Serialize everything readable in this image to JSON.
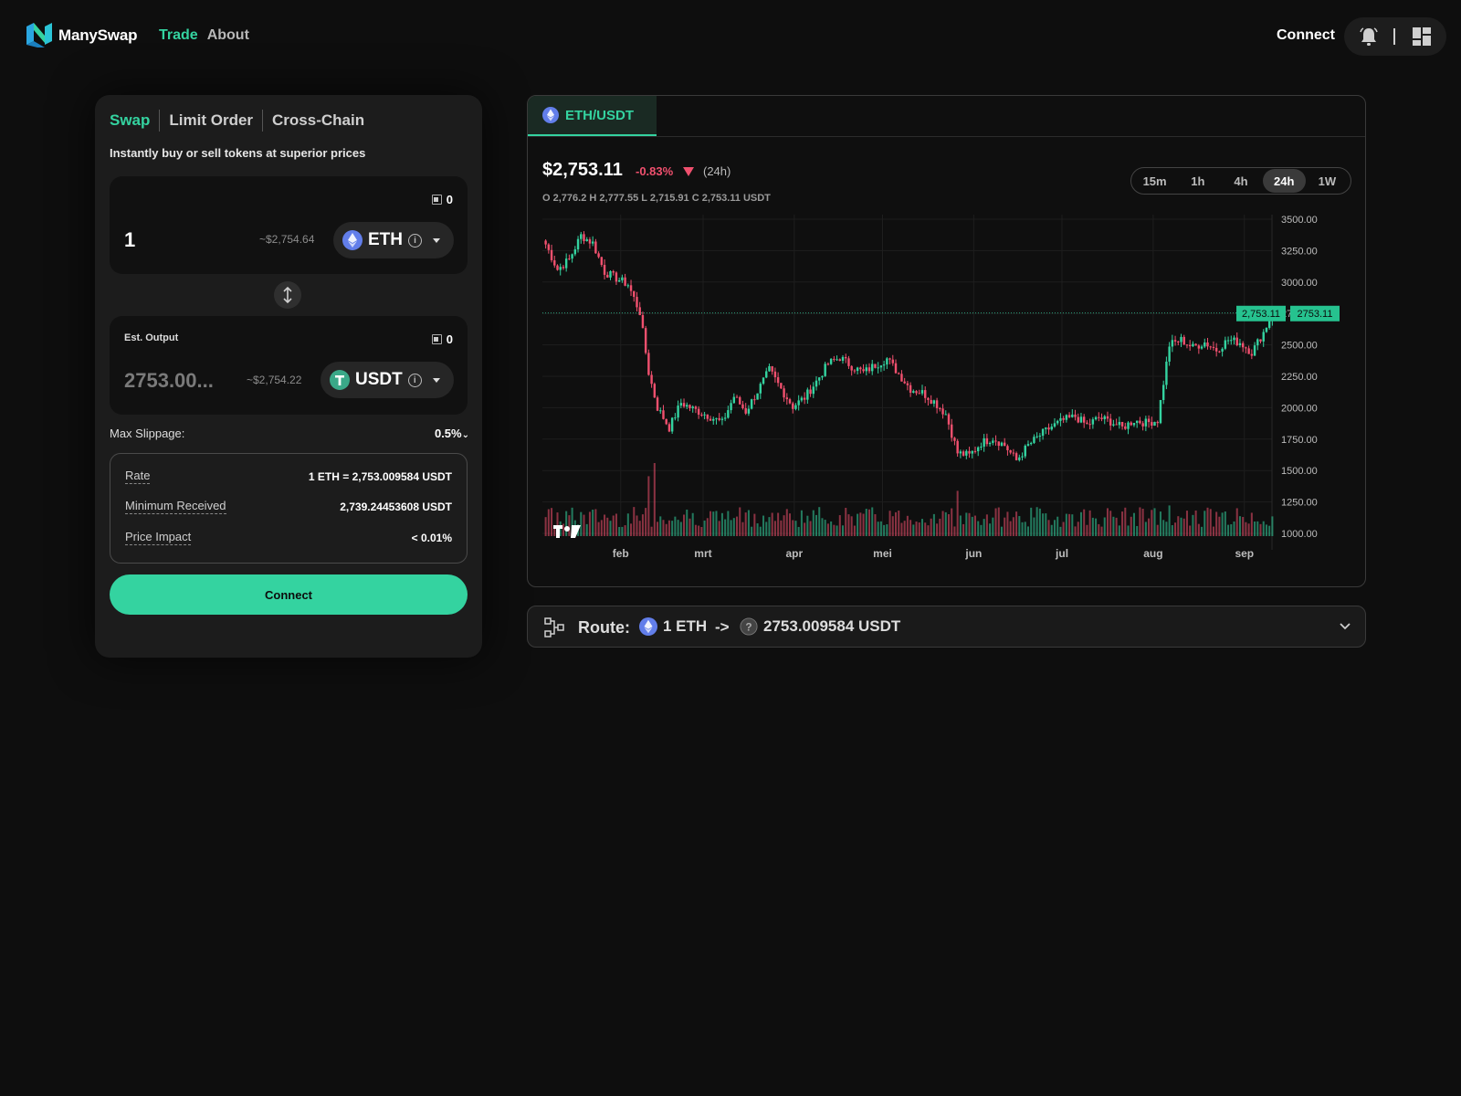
{
  "brand": {
    "name": "ManySwap",
    "accent": "#34d3a0",
    "down": "#f0506e"
  },
  "nav": {
    "trade": "Trade",
    "about": "About"
  },
  "header": {
    "connect": "Connect"
  },
  "swap": {
    "tabs": [
      "Swap",
      "Limit Order",
      "Cross-Chain"
    ],
    "subtitle": "Instantly buy or sell tokens at superior prices",
    "input": {
      "balance": "0",
      "amount": "1",
      "usd": "~$2,754.64",
      "token": "ETH"
    },
    "output": {
      "label": "Est. Output",
      "balance": "0",
      "amount": "2753.00...",
      "usd": "~$2,754.22",
      "token": "USDT"
    },
    "slippage_label": "Max Slippage:",
    "slippage_value": "0.5%",
    "details": [
      {
        "label": "Rate",
        "value": "1 ETH = 2,753.009584 USDT"
      },
      {
        "label": "Minimum Received",
        "value": "2,739.24453608 USDT"
      },
      {
        "label": "Price Impact",
        "value": "< 0.01%"
      }
    ],
    "connect": "Connect"
  },
  "chart": {
    "pair": "ETH/USDT",
    "price": "$2,753.11",
    "change": "-0.83%",
    "period": "(24h)",
    "ohlc": "O 2,776.2 H 2,777.55 L 2,715.91 C 2,753.11 USDT",
    "timeframes": [
      "15m",
      "1h",
      "4h",
      "24h",
      "1W"
    ],
    "active_timeframe": "24h",
    "last_label": "2,753.11",
    "last_axis_label": "2753.11"
  },
  "chart_data": {
    "type": "candlestick",
    "yticks": [
      "3500.00",
      "3250.00",
      "3000.00",
      "2750.00",
      "2500.00",
      "2250.00",
      "2000.00",
      "1750.00",
      "1500.00",
      "1250.00",
      "1000.00"
    ],
    "ylim": [
      1000,
      3500
    ],
    "xticks": [
      "feb",
      "mrt",
      "apr",
      "mei",
      "jun",
      "jul",
      "aug",
      "sep"
    ],
    "last_price": 2753.11,
    "close_anchors": [
      [
        0,
        3300
      ],
      [
        4,
        3100
      ],
      [
        8,
        3180
      ],
      [
        12,
        3370
      ],
      [
        16,
        3310
      ],
      [
        20,
        3080
      ],
      [
        24,
        3030
      ],
      [
        28,
        2980
      ],
      [
        32,
        2760
      ],
      [
        35,
        2280
      ],
      [
        38,
        2000
      ],
      [
        42,
        1840
      ],
      [
        46,
        2040
      ],
      [
        50,
        1990
      ],
      [
        55,
        1940
      ],
      [
        60,
        1880
      ],
      [
        64,
        2090
      ],
      [
        68,
        1970
      ],
      [
        72,
        2130
      ],
      [
        76,
        2300
      ],
      [
        80,
        2150
      ],
      [
        84,
        2010
      ],
      [
        88,
        2080
      ],
      [
        92,
        2210
      ],
      [
        96,
        2350
      ],
      [
        100,
        2400
      ],
      [
        104,
        2330
      ],
      [
        108,
        2280
      ],
      [
        112,
        2340
      ],
      [
        116,
        2390
      ],
      [
        120,
        2270
      ],
      [
        124,
        2150
      ],
      [
        128,
        2120
      ],
      [
        132,
        2050
      ],
      [
        136,
        1950
      ],
      [
        140,
        1640
      ],
      [
        144,
        1620
      ],
      [
        148,
        1720
      ],
      [
        152,
        1760
      ],
      [
        156,
        1700
      ],
      [
        160,
        1580
      ],
      [
        164,
        1700
      ],
      [
        168,
        1780
      ],
      [
        172,
        1850
      ],
      [
        176,
        1900
      ],
      [
        180,
        1930
      ],
      [
        184,
        1860
      ],
      [
        188,
        1920
      ],
      [
        192,
        1890
      ],
      [
        196,
        1840
      ],
      [
        200,
        1900
      ],
      [
        204,
        1880
      ],
      [
        208,
        1900
      ],
      [
        212,
        2500
      ],
      [
        216,
        2540
      ],
      [
        220,
        2480
      ],
      [
        224,
        2520
      ],
      [
        228,
        2460
      ],
      [
        232,
        2540
      ],
      [
        236,
        2520
      ],
      [
        240,
        2440
      ],
      [
        244,
        2600
      ],
      [
        247,
        2753
      ]
    ],
    "volume_spikes": [
      [
        35,
        0.82
      ],
      [
        37,
        1.0
      ],
      [
        140,
        0.62
      ],
      [
        212,
        0.42
      ]
    ]
  },
  "route": {
    "label": "Route:",
    "from": "1 ETH",
    "arrow": "->",
    "to": "2753.009584 USDT"
  }
}
